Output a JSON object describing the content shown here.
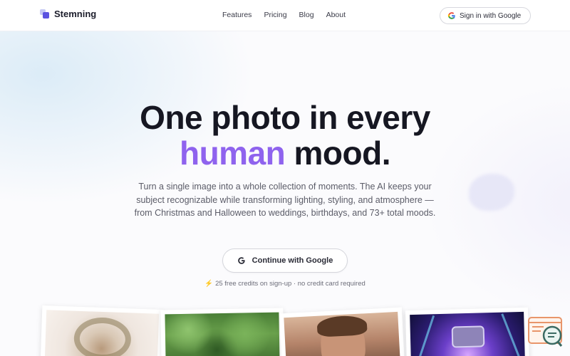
{
  "brand": {
    "name": "Stemning"
  },
  "nav": {
    "items": [
      "Features",
      "Pricing",
      "Blog",
      "About"
    ]
  },
  "header": {
    "signin_label": "Sign in with Google"
  },
  "hero": {
    "title_line1": "One photo in every",
    "title_accent": "human",
    "title_rest": "mood.",
    "subtitle": "Turn a single image into a whole collection of moments. The AI keeps your subject recognizable while transforming lighting, styling, and atmosphere — from Christmas and Halloween to weddings, birthdays, and 73+ total moods.",
    "cta_label": "Continue with Google",
    "credits_icon": "⚡",
    "credits_note": "25 free credits on sign-up · no credit card required"
  },
  "gallery": {
    "photos": [
      {
        "theme": "christmas-wreath"
      },
      {
        "theme": "outdoor-greenery"
      },
      {
        "theme": "portrait"
      },
      {
        "theme": "neon-party"
      }
    ]
  },
  "colors": {
    "accent": "#8f63ee",
    "logo_primary": "#5b53e0",
    "logo_secondary": "#c4c8f4",
    "text_dark": "#161722",
    "text_muted": "#5b5c68",
    "bolt": "#f3a01b",
    "chat_widget": "#e8956a"
  },
  "icons": {
    "logo": "stacked-squares-logo-icon",
    "google": "google-g-icon",
    "bolt": "lightning-bolt-icon",
    "chat": "chat-support-icon"
  }
}
